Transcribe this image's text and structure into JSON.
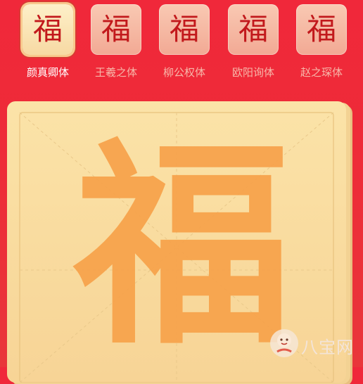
{
  "font_options": [
    {
      "glyph": "福",
      "label": "颜真卿体",
      "selected": true
    },
    {
      "glyph": "福",
      "label": "王羲之体",
      "selected": false
    },
    {
      "glyph": "福",
      "label": "柳公权体",
      "selected": false
    },
    {
      "glyph": "福",
      "label": "欧阳询体",
      "selected": false
    },
    {
      "glyph": "福",
      "label": "赵之琛体",
      "selected": false
    }
  ],
  "canvas": {
    "character": "福"
  },
  "watermark": {
    "text": "八宝网"
  },
  "colors": {
    "background": "#ee2b38",
    "selected_label": "#ffffff",
    "label": "#f7b7a9",
    "glyph": "#c2191c",
    "big_char": "#f7a24a",
    "paper": "#fbe3a8"
  }
}
